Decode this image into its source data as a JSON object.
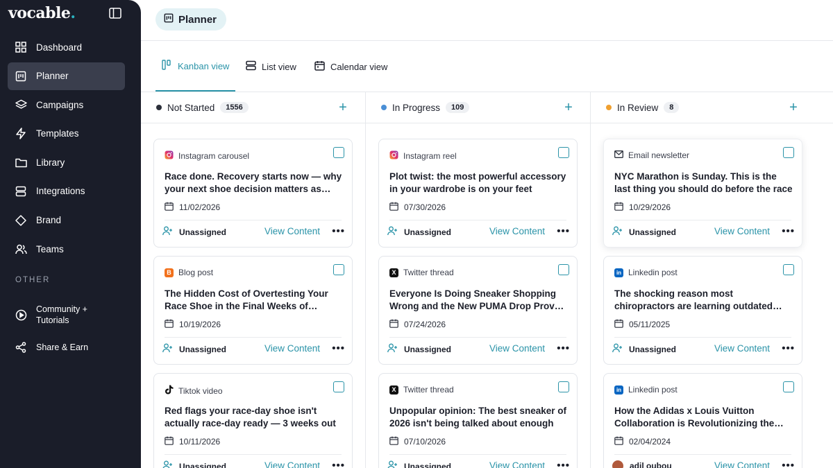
{
  "app": {
    "logo": "vocable",
    "logo_dot": "."
  },
  "sidebar": {
    "items": [
      {
        "label": "Dashboard",
        "icon": "dashboard-icon"
      },
      {
        "label": "Planner",
        "icon": "planner-icon",
        "active": true
      },
      {
        "label": "Campaigns",
        "icon": "layers-icon"
      },
      {
        "label": "Templates",
        "icon": "lightning-icon"
      },
      {
        "label": "Library",
        "icon": "folder-icon"
      },
      {
        "label": "Integrations",
        "icon": "integrations-icon"
      },
      {
        "label": "Brand",
        "icon": "diamond-icon"
      },
      {
        "label": "Teams",
        "icon": "users-icon"
      }
    ],
    "other_title": "OTHER",
    "other_items": [
      {
        "label": "Community + Tutorials",
        "icon": "play-circle-icon"
      },
      {
        "label": "Share & Earn",
        "icon": "share-icon"
      }
    ]
  },
  "header": {
    "title": "Planner"
  },
  "tabs": [
    {
      "label": "Kanban view",
      "active": true
    },
    {
      "label": "List view"
    },
    {
      "label": "Calendar view"
    }
  ],
  "colors": {
    "accent": "#2a93a8",
    "not_started": "#2b2f3a",
    "in_progress": "#4a8fd6",
    "in_review": "#f0a030"
  },
  "columns": [
    {
      "title": "Not Started",
      "count": "1556",
      "cards": [
        {
          "type": "Instagram carousel",
          "type_icon": "instagram-icon",
          "title": "Race done. Recovery starts now — why your next shoe decision matters as much as the race itself",
          "date": "11/02/2026",
          "assignee": "Unassigned",
          "view": "View Content",
          "more": "•••"
        },
        {
          "type": "Blog post",
          "type_icon": "blogger-icon",
          "title": "The Hidden Cost of Overtesting Your Race Shoe in the Final Weeks of Training",
          "date": "10/19/2026",
          "assignee": "Unassigned",
          "view": "View Content",
          "more": "•••"
        },
        {
          "type": "Tiktok video",
          "type_icon": "tiktok-icon",
          "title": "Red flags your race-day shoe isn't actually race-day ready — 3 weeks out",
          "date": "10/11/2026",
          "assignee": "Unassigned",
          "view": "View Content",
          "more": "•••"
        }
      ]
    },
    {
      "title": "In Progress",
      "count": "109",
      "cards": [
        {
          "type": "Instagram reel",
          "type_icon": "instagram-icon",
          "title": "Plot twist: the most powerful accessory in your wardrobe is on your feet",
          "date": "07/30/2026",
          "assignee": "Unassigned",
          "view": "View Content",
          "more": "•••"
        },
        {
          "type": "Twitter thread",
          "type_icon": "x-icon",
          "title": "Everyone Is Doing Sneaker Shopping Wrong and the New PUMA Drop Proves It",
          "date": "07/24/2026",
          "assignee": "Unassigned",
          "view": "View Content",
          "more": "•••"
        },
        {
          "type": "Twitter thread",
          "type_icon": "x-icon",
          "title": "Unpopular opinion: The best sneaker of 2026 isn't being talked about enough",
          "date": "07/10/2026",
          "assignee": "Unassigned",
          "view": "View Content",
          "more": "•••"
        }
      ]
    },
    {
      "title": "In Review",
      "count": "8",
      "cards": [
        {
          "type": "Email newsletter",
          "type_icon": "mail-icon",
          "title": "NYC Marathon is Sunday. This is the last thing you should do before the race",
          "date": "10/29/2026",
          "assignee": "Unassigned",
          "view": "View Content",
          "more": "•••"
        },
        {
          "type": "Linkedin post",
          "type_icon": "linkedin-icon",
          "title": "The shocking reason most chiropractors are learning outdated methods",
          "date": "05/11/2025",
          "assignee": "Unassigned",
          "view": "View Content",
          "more": "•••"
        },
        {
          "type": "Linkedin post",
          "type_icon": "linkedin-icon",
          "title": "How the Adidas x Louis Vuitton Collaboration is Revolutionizing the Industry",
          "date": "02/04/2024",
          "assignee": "adil oubou",
          "view": "View Content",
          "more": "•••"
        }
      ]
    }
  ]
}
